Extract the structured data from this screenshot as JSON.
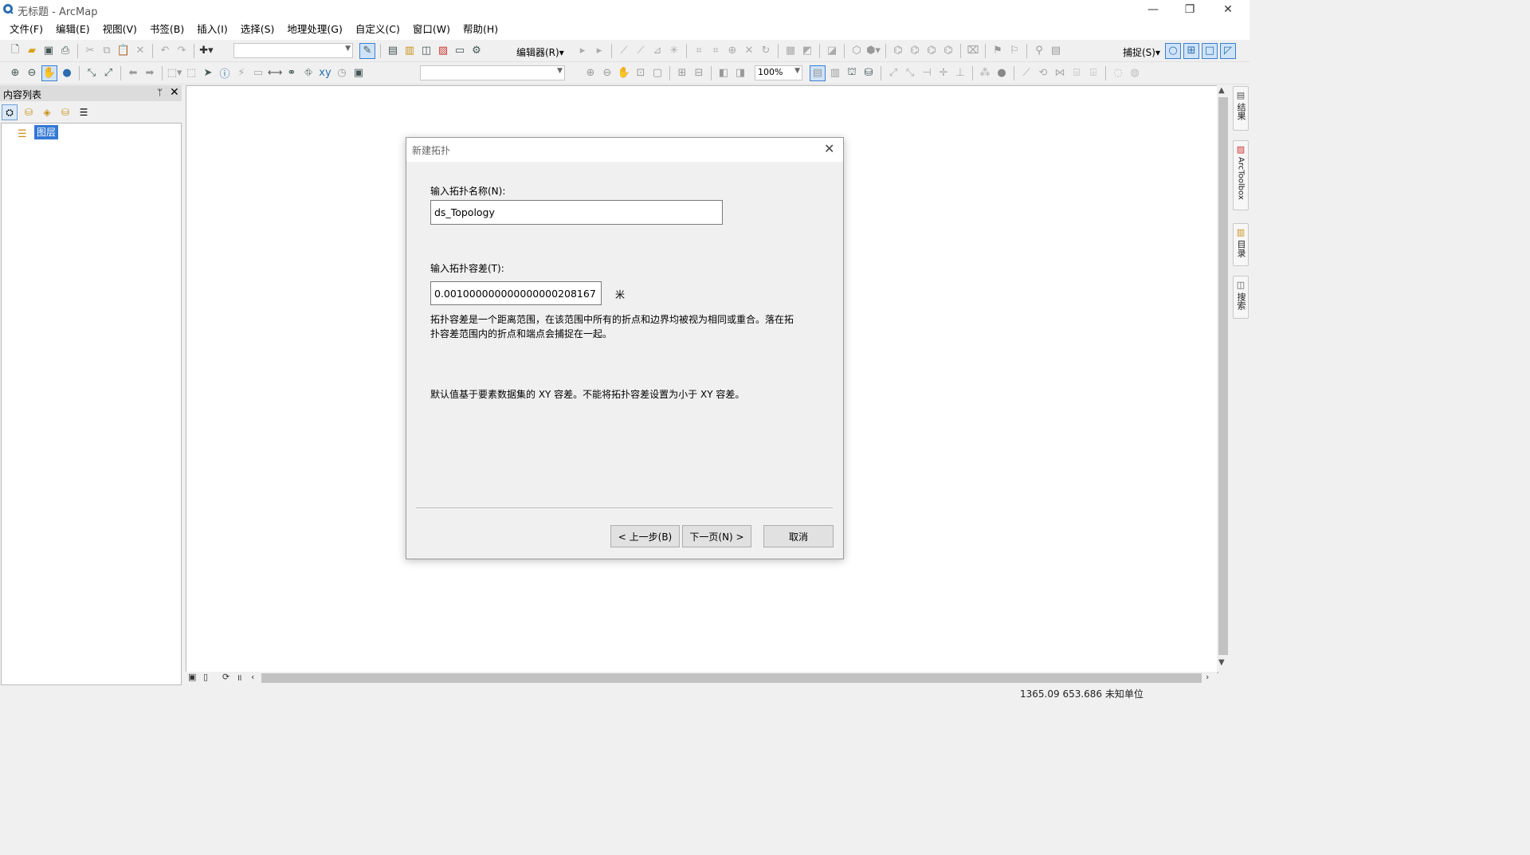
{
  "window": {
    "title": "无标题 - ArcMap",
    "minimize": "—",
    "restore": "❐",
    "close": "✕"
  },
  "menu": [
    "文件(F)",
    "编辑(E)",
    "视图(V)",
    "书签(B)",
    "插入(I)",
    "选择(S)",
    "地理处理(G)",
    "自定义(C)",
    "窗口(W)",
    "帮助(H)"
  ],
  "toolbar": {
    "editor_label": "编辑器(R)▾",
    "snapping_label": "捕捉(S)▾",
    "zoom_value": "100%"
  },
  "toc": {
    "title": "内容列表",
    "pin": "ᛘ",
    "close": "✕",
    "layer_root": "图层"
  },
  "side_tabs": [
    "结果",
    "ArcToolbox",
    "目录",
    "搜索"
  ],
  "status": {
    "coords": "1365.09  653.686 未知单位"
  },
  "dialog": {
    "title": "新建拓扑",
    "name_label": "输入拓扑名称(N):",
    "name_value": "ds_Topology",
    "tolerance_label": "输入拓扑容差(T):",
    "tolerance_value": "0.001000000000000000208167",
    "unit": "米",
    "description": "拓扑容差是一个距离范围，在该范围中所有的折点和边界均被视为相同或重合。落在拓扑容差范围内的折点和端点会捕捉在一起。",
    "default_note": "默认值基于要素数据集的 XY 容差。不能将拓扑容差设置为小于 XY 容差。",
    "back_button": "< 上一步(B)",
    "next_button": "下一页(N) >",
    "cancel_button": "取消"
  }
}
